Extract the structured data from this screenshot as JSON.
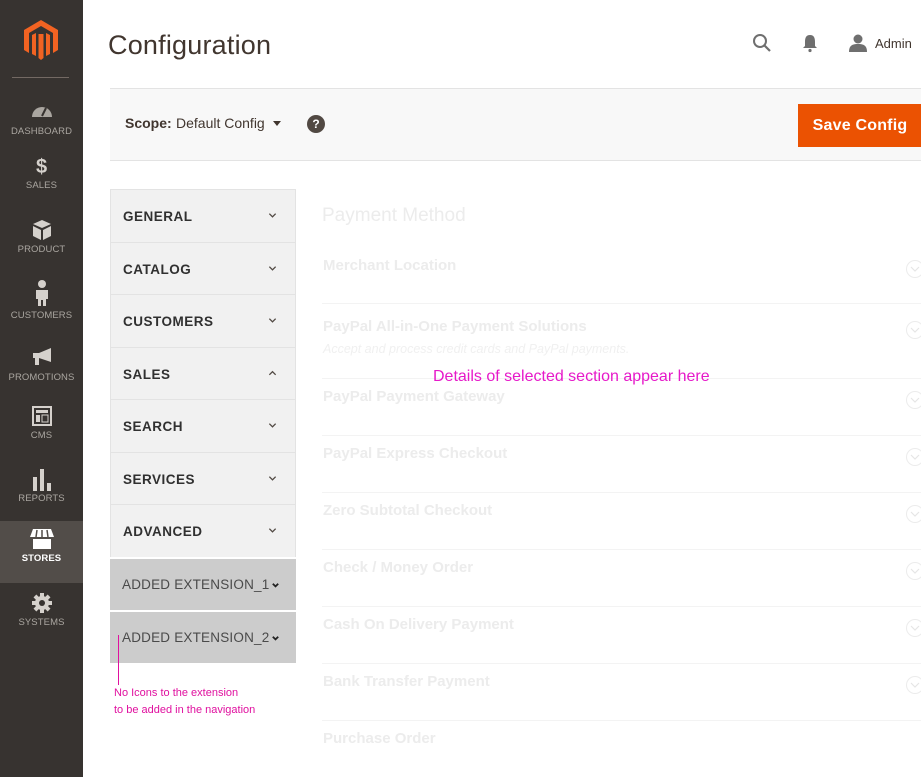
{
  "admin_menu": {
    "logo": "magento-logo",
    "items": [
      {
        "label": "DASHBOARD",
        "icon": "dashboard-icon",
        "active": false
      },
      {
        "label": "SALES",
        "icon": "dollar-icon",
        "active": false
      },
      {
        "label": "PRODUCT",
        "icon": "box-icon",
        "active": false
      },
      {
        "label": "CUSTOMERS",
        "icon": "person-icon",
        "active": false
      },
      {
        "label": "PROMOTIONS",
        "icon": "megaphone-icon",
        "active": false
      },
      {
        "label": "CMS",
        "icon": "layout-icon",
        "active": false
      },
      {
        "label": "REPORTS",
        "icon": "bar-chart-icon",
        "active": false
      },
      {
        "label": "STORES",
        "icon": "store-icon",
        "active": true
      },
      {
        "label": "SYSTEMS",
        "icon": "gear-icon",
        "active": false
      }
    ]
  },
  "header": {
    "title": "Configuration",
    "user_name": "Admin"
  },
  "scope_bar": {
    "label": "Scope:",
    "selected": "Default Config",
    "help": "?",
    "save_label": "Save Config"
  },
  "colors": {
    "accent": "#eb5202",
    "menu_bg": "#373330",
    "menu_active": "#524d49",
    "annotation": "#e0109f"
  },
  "config_nav": {
    "items": [
      {
        "label": "GENERAL",
        "expanded": false
      },
      {
        "label": "CATALOG",
        "expanded": false
      },
      {
        "label": "CUSTOMERS",
        "expanded": false
      },
      {
        "label": "SALES",
        "expanded": true
      },
      {
        "label": "SEARCH",
        "expanded": false
      },
      {
        "label": "SERVICES",
        "expanded": false
      },
      {
        "label": "ADVANCED",
        "expanded": false
      }
    ],
    "extensions": [
      {
        "label": "ADDED EXTENSION_1"
      },
      {
        "label": "ADDED EXTENSION_2"
      }
    ]
  },
  "annotations": {
    "details": "Details of selected section appear here",
    "nav_note_line1": "No Icons to the extension",
    "nav_note_line2": "to be added in the navigation"
  },
  "content": {
    "section_title": "Payment Method",
    "rows": [
      {
        "title": "Merchant Location",
        "subtitle": ""
      },
      {
        "title": "PayPal All-in-One Payment Solutions",
        "subtitle": "Accept and process credit cards and PayPal payments."
      },
      {
        "title": "PayPal Payment Gateway",
        "subtitle": ""
      },
      {
        "title": "PayPal Express Checkout",
        "subtitle": ""
      },
      {
        "title": "Zero Subtotal Checkout",
        "subtitle": ""
      },
      {
        "title": "Check / Money Order",
        "subtitle": ""
      },
      {
        "title": "Cash On Delivery Payment",
        "subtitle": ""
      },
      {
        "title": "Bank Transfer Payment",
        "subtitle": ""
      },
      {
        "title": "Purchase Order",
        "subtitle": ""
      }
    ]
  }
}
